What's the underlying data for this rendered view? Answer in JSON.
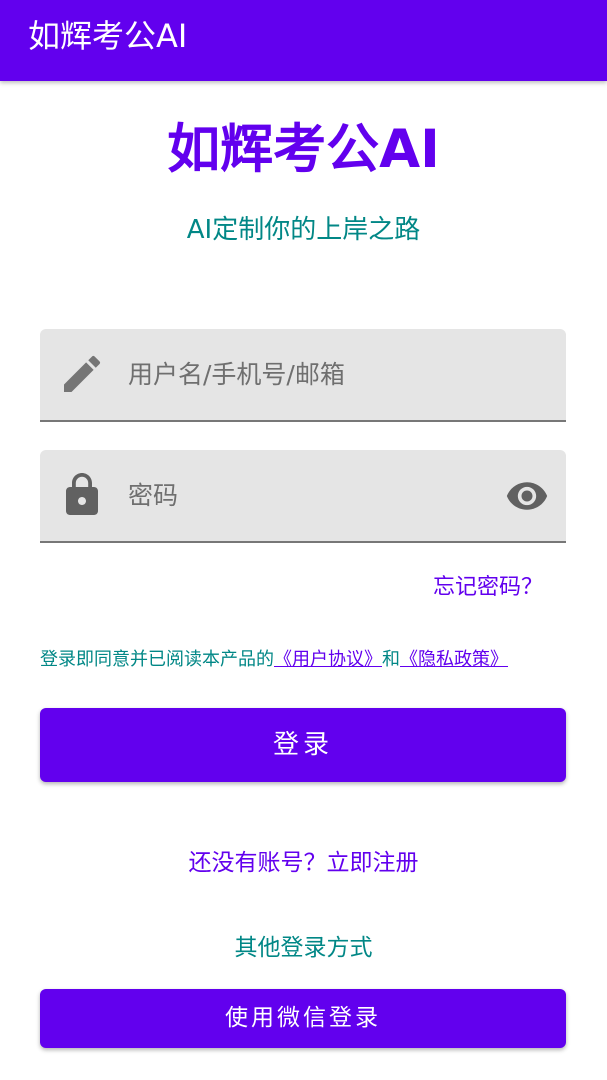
{
  "appbar": {
    "title": "如辉考公AI"
  },
  "header": {
    "title": "如辉考公AI",
    "subtitle": "AI定制你的上岸之路"
  },
  "form": {
    "username": {
      "placeholder": "用户名/手机号/邮箱",
      "value": "",
      "icon": "pencil-icon"
    },
    "password": {
      "placeholder": "密码",
      "value": "",
      "icon": "lock-icon",
      "toggle_icon": "eye-icon"
    },
    "forgot_label": "忘记密码？"
  },
  "agreement": {
    "prefix": "登录即同意并已阅读本产品的",
    "user_agreement": "《用户协议》",
    "conjunction": "和",
    "privacy_policy": "《隐私政策》"
  },
  "actions": {
    "login_label": "登录",
    "register_label": "还没有账号？立即注册",
    "other_login_label": "其他登录方式",
    "wechat_login_label": "使用微信登录"
  },
  "colors": {
    "primary": "#6200EE",
    "secondary": "#018786",
    "field_background": "#E5E5E5",
    "icon_gray": "#757575"
  }
}
